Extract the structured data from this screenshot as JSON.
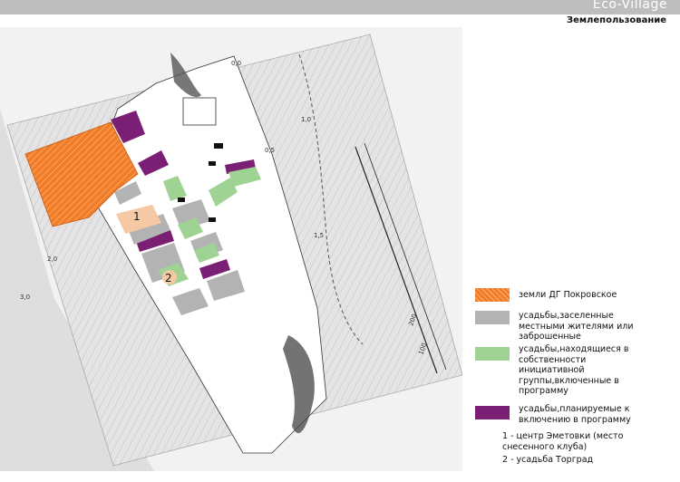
{
  "header": {
    "brand": "Eco-Village",
    "title": "Землепользование"
  },
  "map": {
    "markers": [
      "1",
      "2"
    ],
    "scale_numbers": [
      "0,0",
      "0,5",
      "1,0",
      "1,5",
      "2,0",
      "3,0",
      "200",
      "100"
    ]
  },
  "legend": {
    "items": [
      {
        "label": "земли ДГ Покровское",
        "color": "#f07c2a",
        "icon": "hatched-orange-swatch"
      },
      {
        "label": "усадьбы,заселенные местными жителями или заброшенные",
        "color": "#b3b3b3",
        "icon": "grey-swatch"
      },
      {
        "label": "усадьбы,находящиеся в собственности инициативной группы,включенные в программу",
        "color": "#9fd394",
        "icon": "green-swatch"
      },
      {
        "label": "усадьбы,планируемые к включению в программу",
        "color": "#7a1f74",
        "icon": "purple-swatch"
      }
    ],
    "notes": [
      "1 - центр Эметовки (место снесенного клуба)",
      "2 - усадьба Торград"
    ]
  },
  "colors": {
    "peach": "#f5c9a3",
    "paper": "#d9d9d9",
    "terrain": "#888888"
  }
}
